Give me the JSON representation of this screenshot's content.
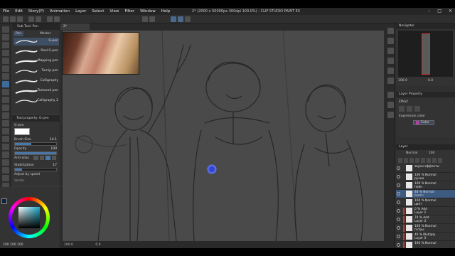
{
  "menu": {
    "items": [
      "File",
      "Edit",
      "Story(P)",
      "Animation",
      "Layer",
      "Select",
      "View",
      "Filter",
      "Window",
      "Help"
    ],
    "doc_title": "2* (2000 x 50000px 300dpi 100.0%) - CLIP STUDIO PAINT EX"
  },
  "subtool": {
    "tabs": [
      "Sub Tool: Pen",
      "Pen",
      "Marker"
    ],
    "items": [
      {
        "label": "G-pen",
        "selected": true
      },
      {
        "label": "Real G-pen",
        "selected": false
      },
      {
        "label": "Mapping pen",
        "selected": false
      },
      {
        "label": "Turnip pen",
        "selected": false
      },
      {
        "label": "Calligraphy",
        "selected": false
      },
      {
        "label": "Textured pen",
        "selected": false
      },
      {
        "label": "Calligraphy 2",
        "selected": false
      }
    ]
  },
  "tool_property": {
    "header": "Tool property: G-pen",
    "tool_name": "G-pen",
    "brush_size_label": "Brush Size",
    "brush_size_value": "14.1",
    "opacity_label": "Opacity",
    "opacity_value": "100",
    "antialias_label": "Anti-alias",
    "stabilization_label": "Stabilization",
    "stabilization_value": "17",
    "adjust_label": "Adjust by speed",
    "vector_label": "Vector"
  },
  "color": {
    "footer": "100 100 100",
    "main_color": "#10223a"
  },
  "canvas": {
    "tab_label": "2*",
    "status_zoom": "100.0",
    "status_coords": "0.0"
  },
  "navigator": {
    "header": "Navigator",
    "zoom": "100.0",
    "angle": "0.0"
  },
  "layer_property": {
    "header": "Layer Property",
    "effect_label": "Effect",
    "expression_label": "Expression color",
    "expression_value": "Color"
  },
  "layers": {
    "header": "Layer",
    "blend_mode": "Normal",
    "opacity": "100",
    "rows": [
      {
        "line1": "звуки эффекты",
        "line2": "",
        "selected": false,
        "red": false
      },
      {
        "line1": "100 % Normal",
        "line2": "ручки",
        "selected": false,
        "red": false
      },
      {
        "line1": "100 % Normal",
        "line2": "пейн",
        "selected": false,
        "red": false
      },
      {
        "line1": "48 % Normal",
        "line2": "скетч",
        "selected": true,
        "red": false
      },
      {
        "line1": "100 % Normal",
        "line2": "цвет",
        "selected": false,
        "red": false
      },
      {
        "line1": "0 % Add",
        "line2": "Layer 2",
        "selected": false,
        "red": true
      },
      {
        "line1": "74 % Add",
        "line2": "Layer 4",
        "selected": false,
        "red": true
      },
      {
        "line1": "100 % Normal",
        "line2": "гетры",
        "selected": false,
        "red": true
      },
      {
        "line1": "46 % Multiply",
        "line2": "Layer 3",
        "selected": false,
        "red": true
      },
      {
        "line1": "100 % Normal",
        "line2": "",
        "selected": false,
        "red": true
      }
    ]
  },
  "accent_colors": {
    "selection_blue": "#3d5a80",
    "tool_selected": "#3d6b9a",
    "layer_red": "#c0392b"
  }
}
